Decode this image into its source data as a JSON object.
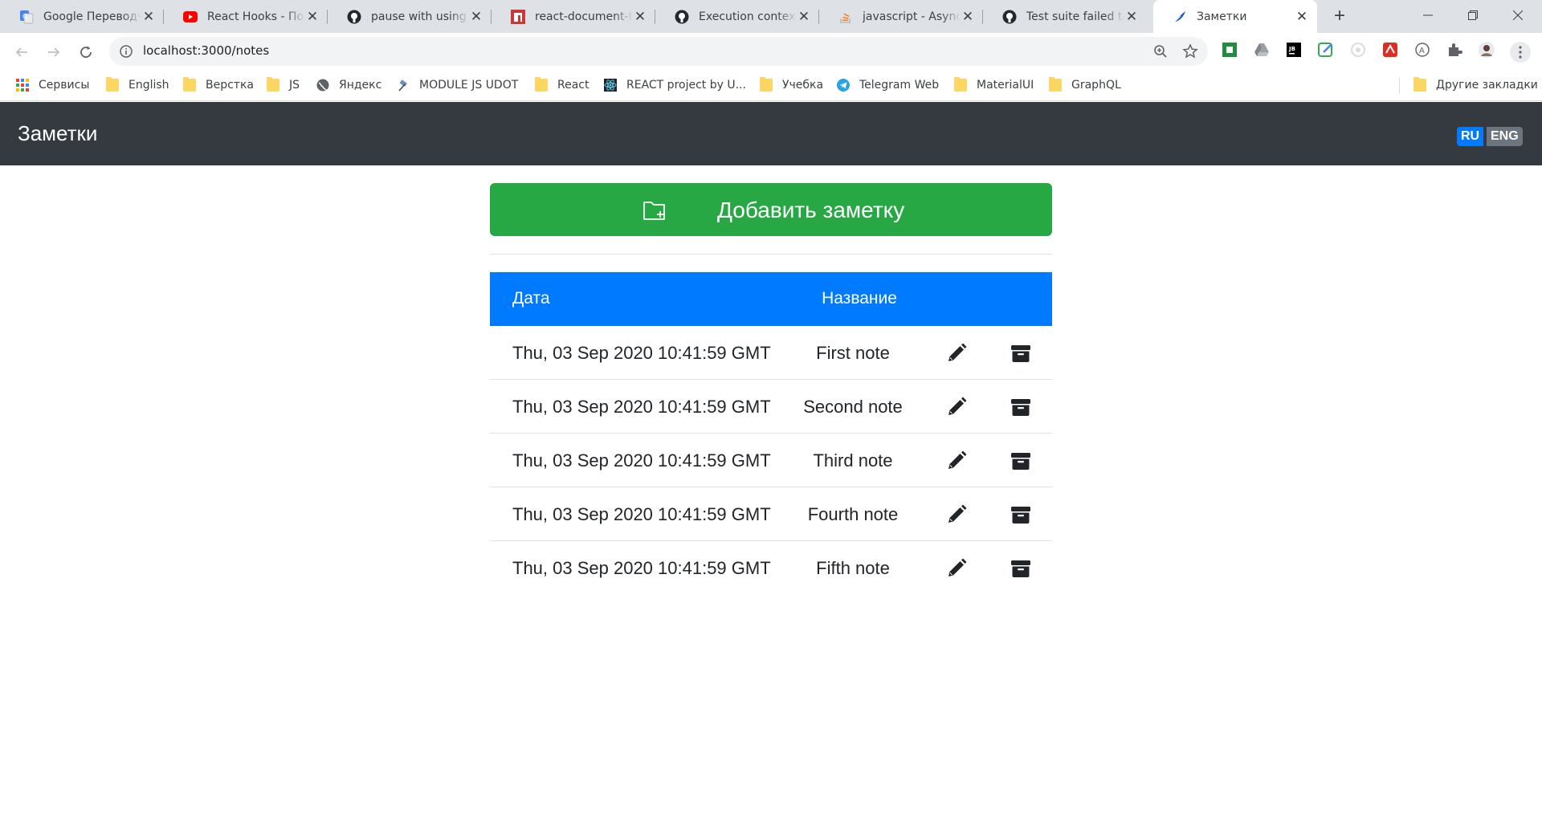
{
  "browser": {
    "tabs": [
      {
        "title": "Google Переводчик",
        "icon": "google-translate-icon"
      },
      {
        "title": "React Hooks - Полный курс",
        "icon": "youtube-icon"
      },
      {
        "title": "pause with using puppeteer",
        "icon": "github-icon"
      },
      {
        "title": "react-document-title",
        "icon": "npm-icon"
      },
      {
        "title": "Execution context",
        "icon": "github-icon"
      },
      {
        "title": "javascript - Async",
        "icon": "stackoverflow-icon"
      },
      {
        "title": "Test suite failed to run",
        "icon": "github-icon"
      },
      {
        "title": "Заметки",
        "icon": "feather-icon",
        "active": true
      }
    ],
    "url": "localhost:3000/notes",
    "bookmarks": [
      {
        "label": "Сервисы",
        "icon": "apps-grid-icon"
      },
      {
        "label": "English",
        "icon": "folder-icon"
      },
      {
        "label": "Верстка",
        "icon": "folder-icon"
      },
      {
        "label": "JS",
        "icon": "folder-icon"
      },
      {
        "label": "Яндекс",
        "icon": "globe-icon"
      },
      {
        "label": "MODULE JS UDOT",
        "icon": "satellite-icon"
      },
      {
        "label": "React",
        "icon": "folder-icon"
      },
      {
        "label": "REACT project by U...",
        "icon": "react-icon"
      },
      {
        "label": "Учебка",
        "icon": "folder-icon"
      },
      {
        "label": "Telegram Web",
        "icon": "telegram-icon"
      },
      {
        "label": "MaterialUI",
        "icon": "folder-icon"
      },
      {
        "label": "GraphQL",
        "icon": "folder-icon"
      },
      {
        "label": "Другие закладки",
        "icon": "folder-icon"
      }
    ]
  },
  "app": {
    "brand": "Заметки",
    "languages": [
      "RU",
      "ENG"
    ],
    "add_button_label": "Добавить заметку",
    "table": {
      "headers": {
        "date": "Дата",
        "title": "Название"
      },
      "rows": [
        {
          "date": "Thu, 03 Sep 2020 10:41:59 GMT",
          "title": "First note"
        },
        {
          "date": "Thu, 03 Sep 2020 10:41:59 GMT",
          "title": "Second note"
        },
        {
          "date": "Thu, 03 Sep 2020 10:41:59 GMT",
          "title": "Third note"
        },
        {
          "date": "Thu, 03 Sep 2020 10:41:59 GMT",
          "title": "Fourth note"
        },
        {
          "date": "Thu, 03 Sep 2020 10:41:59 GMT",
          "title": "Fifth note"
        }
      ]
    },
    "colors": {
      "navbar": "#343a40",
      "add_button": "#28a745",
      "table_header": "#007bff",
      "lang_active": "#007bff",
      "lang_inactive": "#6c757d"
    }
  }
}
